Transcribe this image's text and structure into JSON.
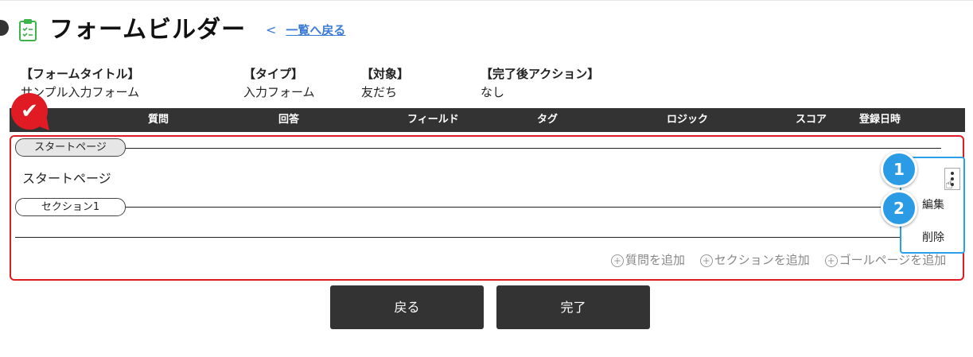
{
  "header": {
    "title": "フォームビルダー",
    "back_chevron": "<",
    "back_link": "一覧へ戻る"
  },
  "meta": {
    "form_title_label": "【フォームタイトル】",
    "form_title_value": "サンプル入力フォーム",
    "type_label": "【タイプ】",
    "type_value": "入力フォーム",
    "target_label": "【対象】",
    "target_value": "友だち",
    "action_label": "【完了後アクション】",
    "action_value": "なし"
  },
  "table_header": [
    "質問",
    "回答",
    "フィールド",
    "タグ",
    "ロジック",
    "スコア",
    "登録日時"
  ],
  "builder": {
    "start_pill": "スタートページ",
    "start_text": "スタートページ",
    "section_pill": "セクション1",
    "add_question": "質問を追加",
    "add_section": "セクションを追加",
    "add_goal_page": "ゴールページを追加"
  },
  "context_menu": {
    "edit": "編集",
    "delete": "削除"
  },
  "annotations": {
    "step1": "1",
    "step2": "2",
    "check": "✔"
  },
  "buttons": {
    "back": "戻る",
    "done": "完了"
  },
  "icons": {
    "clipboard": "clipboard-icon",
    "kebab": "kebab-menu-icon",
    "pointer": "hand-pointer-icon",
    "plus": "plus-circle-icon"
  },
  "colors": {
    "accent_red": "#e01b23",
    "accent_blue": "#2c9be6",
    "link_blue": "#3a7bd5",
    "dark": "#333333",
    "clipboard_green": "#3cb44b"
  }
}
